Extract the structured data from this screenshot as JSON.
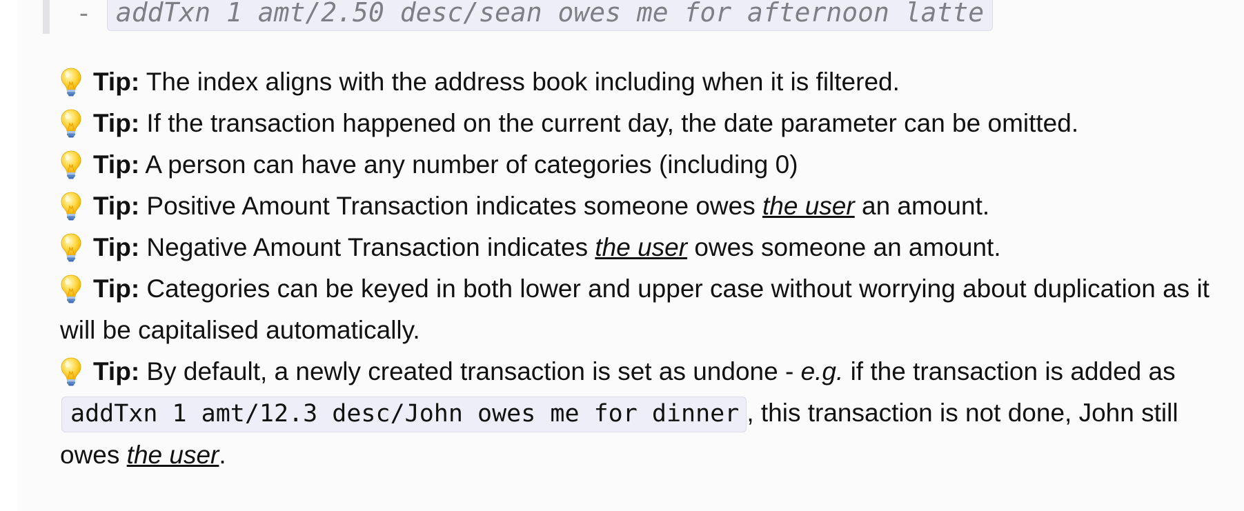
{
  "example": {
    "dash": "-",
    "command": "addTxn 1 amt/2.50 desc/sean owes me for afternoon latte"
  },
  "tips": [
    {
      "label": "Tip:",
      "text": "The index aligns with the address book including when it is filtered."
    },
    {
      "label": "Tip:",
      "text": "If the transaction happened on the current day, the date parameter can be omitted."
    },
    {
      "label": "Tip:",
      "text": "A person can have any number of categories (including 0)"
    },
    {
      "label": "Tip:",
      "before": "Positive Amount Transaction indicates someone owes",
      "link": "the user",
      "after": "an amount."
    },
    {
      "label": "Tip:",
      "before": "Negative Amount Transaction indicates",
      "link": "the user",
      "after": "owes someone an amount."
    },
    {
      "label": "Tip:",
      "text": "Categories can be keyed in both lower and upper case without worrying about duplication as it will be capitalised automatically."
    },
    {
      "label": "Tip:",
      "part1": "By default, a newly created transaction is set as undone -",
      "eg": "e.g.",
      "part2": "if the transaction is added as",
      "code": "addTxn 1 amt/12.3 desc/John owes me for dinner",
      "part3": ", this transaction is not done, John still owes",
      "link": "the user",
      "part4": "."
    }
  ]
}
